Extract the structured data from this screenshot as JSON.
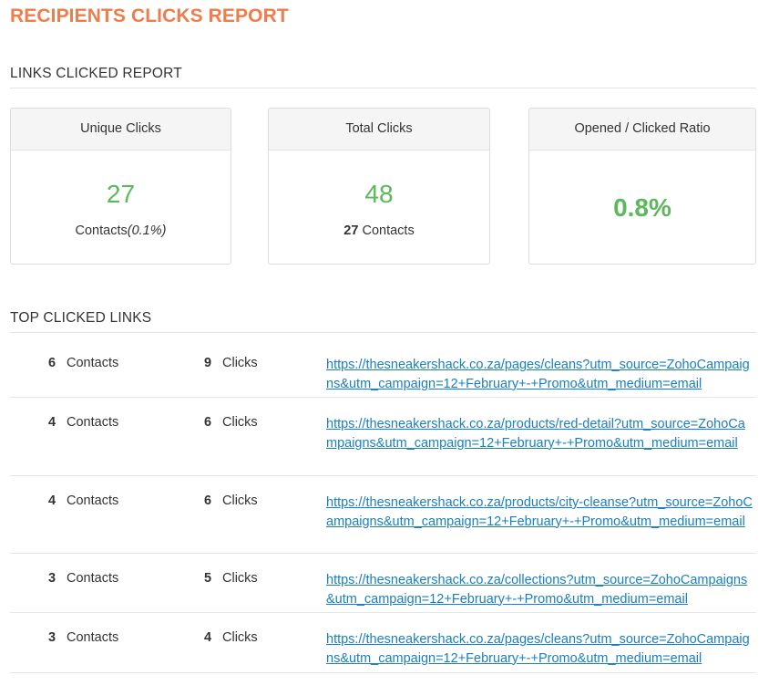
{
  "page_title": "RECIPIENTS CLICKS REPORT",
  "links_clicked_report": {
    "heading": "LINKS CLICKED REPORT",
    "unique_clicks": {
      "label": "Unique Clicks",
      "value": "27",
      "sub_label": "Contacts",
      "sub_pct": "(0.1%)"
    },
    "total_clicks": {
      "label": "Total Clicks",
      "value": "48",
      "sub_count": "27",
      "sub_label": "Contacts"
    },
    "opened_clicked_ratio": {
      "label": "Opened / Clicked Ratio",
      "value": "0.8%"
    }
  },
  "top_clicked_links": {
    "heading": "TOP CLICKED LINKS",
    "rows": [
      {
        "contacts": "6",
        "contacts_label": "Contacts",
        "clicks": "9",
        "clicks_label": "Clicks",
        "url": "https://thesneakershack.co.za/pages/cleans?utm_source=ZohoCampaigns&utm_campaign=12+February+-+Promo&utm_medium=email"
      },
      {
        "contacts": "4",
        "contacts_label": "Contacts",
        "clicks": "6",
        "clicks_label": "Clicks",
        "url": "https://thesneakershack.co.za/products/red-detail?utm_source=ZohoCampaigns&utm_campaign=12+February+-+Promo&utm_medium=email"
      },
      {
        "contacts": "4",
        "contacts_label": "Contacts",
        "clicks": "6",
        "clicks_label": "Clicks",
        "url": "https://thesneakershack.co.za/products/city-cleanse?utm_source=ZohoCampaigns&utm_campaign=12+February+-+Promo&utm_medium=email"
      },
      {
        "contacts": "3",
        "contacts_label": "Contacts",
        "clicks": "5",
        "clicks_label": "Clicks",
        "url": "https://thesneakershack.co.za/collections?utm_source=ZohoCampaigns&utm_campaign=12+February+-+Promo&utm_medium=email"
      },
      {
        "contacts": "3",
        "contacts_label": "Contacts",
        "clicks": "4",
        "clicks_label": "Clicks",
        "url": "https://thesneakershack.co.za/pages/cleans?utm_source=ZohoCampaigns&utm_campaign=12+February+-+Promo&utm_medium=email"
      }
    ]
  },
  "colors": {
    "title": "#f07c4d",
    "metric": "#5cb85c",
    "link": "#1a7fc1"
  }
}
